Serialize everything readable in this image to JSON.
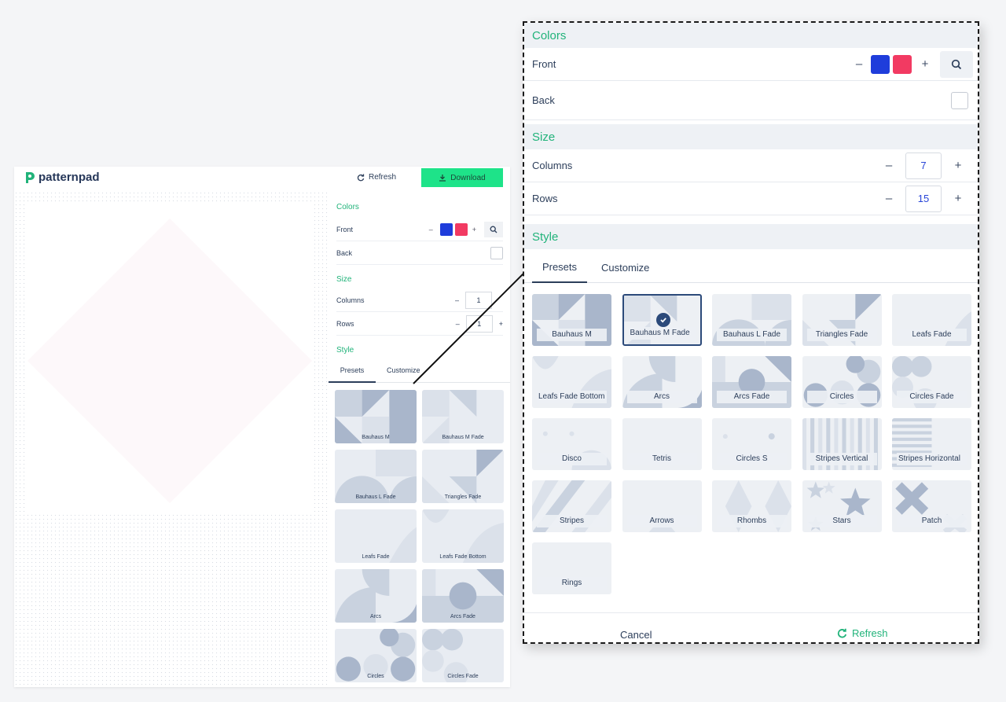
{
  "app": {
    "logo": "patternpad",
    "refresh": "Refresh",
    "download": "Download",
    "colors_heading": "Colors",
    "front_label": "Front",
    "back_label": "Back",
    "size_heading": "Size",
    "columns_label": "Columns",
    "columns_value": "1",
    "rows_label": "Rows",
    "rows_value": "1",
    "style_heading": "Style",
    "tab_presets": "Presets",
    "tab_customize": "Customize",
    "presets": [
      "Bauhaus M",
      "Bauhaus M Fade",
      "Bauhaus L Fade",
      "Triangles Fade",
      "Leafs Fade",
      "Leafs Fade Bottom",
      "Arcs",
      "Arcs Fade",
      "Circles",
      "Circles Fade"
    ]
  },
  "dialog": {
    "colors_heading": "Colors",
    "front_label": "Front",
    "back_label": "Back",
    "size_heading": "Size",
    "columns_label": "Columns",
    "columns_value": "7",
    "rows_label": "Rows",
    "rows_value": "15",
    "style_heading": "Style",
    "tab_presets": "Presets",
    "tab_customize": "Customize",
    "minus": "–",
    "plus": "+",
    "presets": [
      "Bauhaus M",
      "Bauhaus M Fade",
      "Bauhaus L Fade",
      "Triangles Fade",
      "Leafs Fade",
      "Leafs Fade Bottom",
      "Arcs",
      "Arcs Fade",
      "Circles",
      "Circles Fade",
      "Disco",
      "Tetris",
      "Circles S",
      "Stripes Vertical",
      "Stripes Horizontal",
      "Stripes",
      "Arrows",
      "Rhombs",
      "Stars",
      "Patch",
      "Rings"
    ],
    "selected_preset": "Bauhaus M Fade",
    "cancel": "Cancel",
    "refresh": "Refresh"
  },
  "colors": {
    "front_blue": "#1f3ddb",
    "front_pink": "#f23a62",
    "accent_green": "#21b37a",
    "download_green": "#1ee389"
  }
}
